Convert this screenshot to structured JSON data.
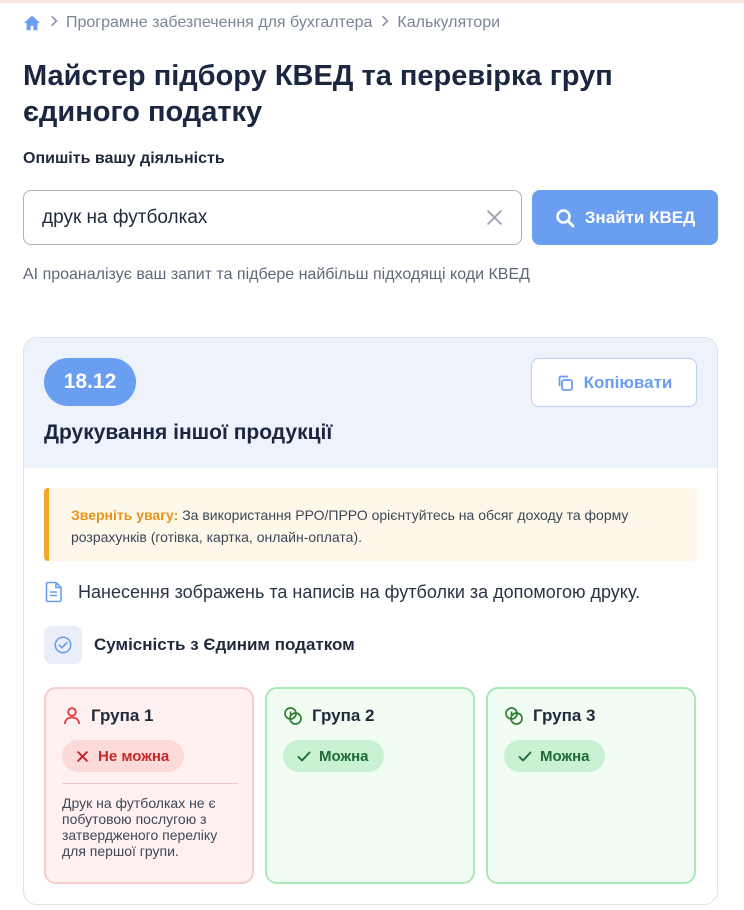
{
  "breadcrumb": {
    "items": [
      "Програмне забезпечення для бухгалтера",
      "Калькулятори"
    ]
  },
  "page": {
    "title": "Майстер підбору КВЕД та перевірка груп єдиного податку",
    "field_label": "Опишіть вашу діяльність"
  },
  "search": {
    "value": "друк на футболках",
    "button_label": "Знайти КВЕД",
    "hint": "AI проаналізує ваш запит та підбере найбільш підходящі коди КВЕД"
  },
  "result": {
    "code": "18.12",
    "copy_label": "Копіювати",
    "title": "Друкування іншої продукції",
    "notice_lead": "Зверніть увагу:",
    "notice_text": " За використання РРО/ПРРО орієнтуйтесь на обсяг доходу та форму розрахунків (готівка, картка, онлайн-оплата).",
    "description": "Нанесення зображень та написів на футболки за допомогою друку.",
    "compat_title": "Сумісність з Єдиним податком",
    "groups": [
      {
        "label": "Група 1",
        "status": "Не можна",
        "note": "Друк на футболках не є побутовою послугою з затвердженого переліку для першої групи."
      },
      {
        "label": "Група 2",
        "status": "Можна"
      },
      {
        "label": "Група 3",
        "status": "Можна"
      }
    ]
  },
  "colors": {
    "accent": "#6a9ef0",
    "warning": "#f3a52a",
    "danger": "#c62828",
    "success": "#1f6b35"
  }
}
